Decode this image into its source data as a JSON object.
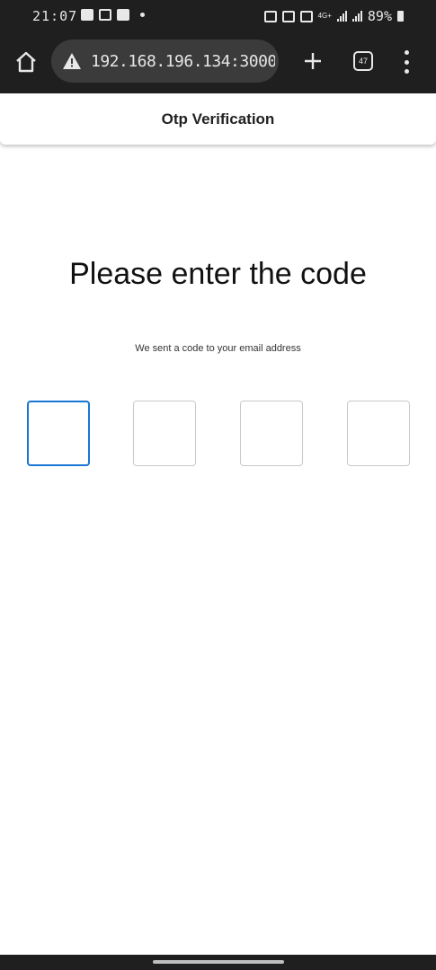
{
  "status_bar": {
    "time": "21:07",
    "network_label": "4G+",
    "battery": "89%"
  },
  "browser": {
    "url": "192.168.196.134:3000,",
    "tab_count": "47",
    "icons": [
      "home-icon",
      "warning-icon",
      "plus-icon",
      "tabs-icon",
      "more-vert-icon"
    ]
  },
  "app_bar": {
    "title": "Otp Verification"
  },
  "main": {
    "heading": "Please enter the code",
    "subtext": "We sent a code to your email address",
    "otp_values": [
      "",
      "",
      "",
      ""
    ]
  },
  "colors": {
    "active_border": "#1976d2",
    "chrome_bg": "#1f1f1f",
    "urlbar_bg": "#3b3b3b"
  }
}
